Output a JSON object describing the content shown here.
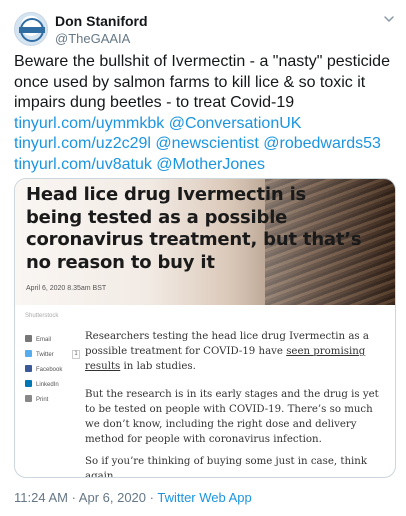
{
  "tweet": {
    "name": "Don Staniford",
    "handle": "@TheGAAIA",
    "text_plain_1": "Beware the bullshit of Ivermectin - a \"nasty\" pesticide once used by salmon farms to kill lice & so toxic it impairs dung beetles - to treat Covid-19 ",
    "link_1": "tinyurl.com/uymmkbk",
    "link_2": "@ConversationUK",
    "link_3": "tinyurl.com/uz2c29l",
    "link_4": "@newscientist",
    "link_5": "@robedwards53",
    "link_6": "tinyurl.com/uv8atuk",
    "link_7": "@MotherJones",
    "timestamp": "11:24 AM · Apr 6, 2020",
    "separator": " · ",
    "source": "Twitter Web App"
  },
  "card": {
    "headline": "Head lice drug Ivermectin is being tested as a possible coronavirus treatment, but that’s no reason to buy it",
    "dateline": "April 6, 2020 8.35am BST",
    "credit": "Shutterstock",
    "share": {
      "email": "Email",
      "twitter": "Twitter",
      "twitter_count": "1",
      "facebook": "Facebook",
      "linkedin": "LinkedIn",
      "print": "Print"
    },
    "para1_a": "Researchers testing the head lice drug Ivermectin as a possible treatment for COVID-19 have ",
    "para1_link": "seen promising results",
    "para1_b": " in lab studies.",
    "para2": "But the research is in its early stages and the drug is yet to be tested on people with COVID-19. There’s so much we don’t know, including the right dose and delivery method for people with coronavirus infection.",
    "para3": "So if you’re thinking of buying some just in case, think again."
  },
  "colors": {
    "link": "#1b95e0",
    "secondary_text": "#657786",
    "border": "#ccd6dd"
  }
}
